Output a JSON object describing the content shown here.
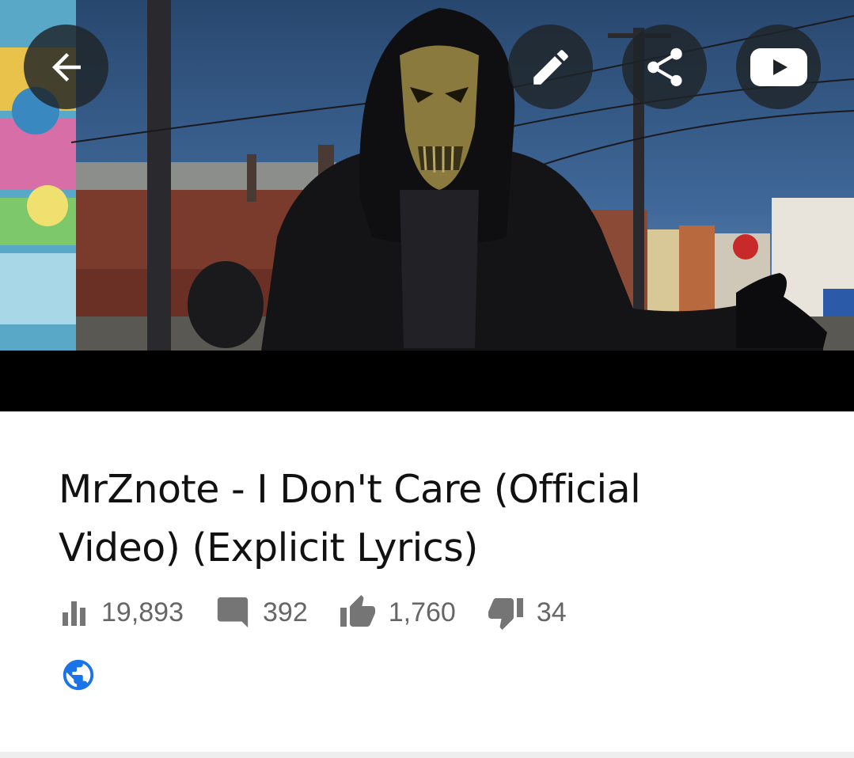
{
  "video": {
    "title": "MrZnote - I Don't Care (Official Video) (Explicit Lyrics)",
    "thumbnail": "masked-figure-street-scene"
  },
  "toolbar": {
    "back_icon": "arrow-left-icon",
    "edit_icon": "pencil-icon",
    "share_icon": "share-icon",
    "youtube_icon": "youtube-play-icon"
  },
  "stats": {
    "views": "19,893",
    "comments": "392",
    "likes": "1,760",
    "dislikes": "34"
  },
  "privacy": {
    "icon": "globe-icon"
  },
  "colors": {
    "overlay_button": "#1e2428",
    "stat_gray": "#666666",
    "title_text": "#111111",
    "public_blue": "#1a73e8"
  }
}
